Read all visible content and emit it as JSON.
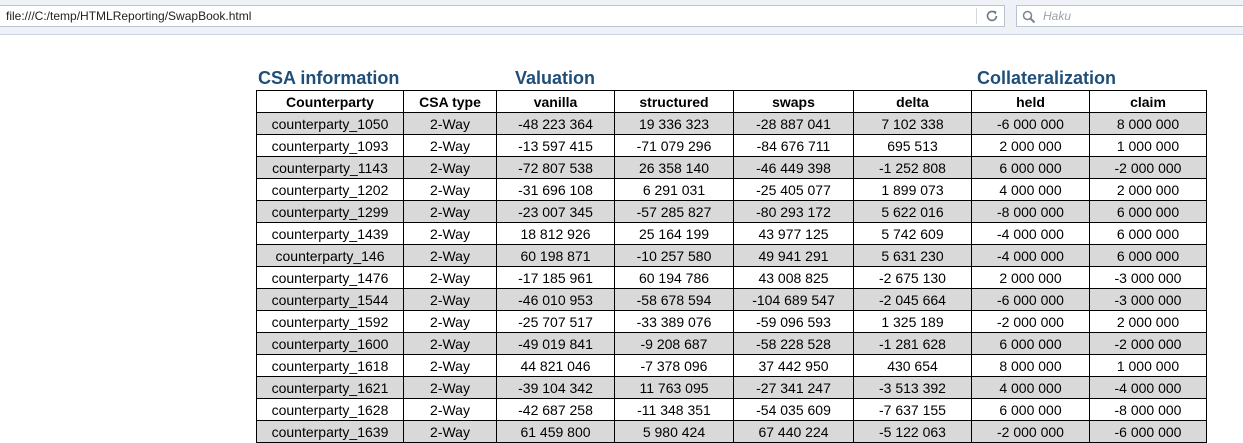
{
  "browser": {
    "url": "file:///C:/temp/HTMLReporting/SwapBook.html",
    "reload_icon": "reload-icon",
    "search_placeholder": "Haku"
  },
  "sections": {
    "csa": "CSA information",
    "valuation": "Valuation",
    "collateralization": "Collateralization"
  },
  "table": {
    "columns": [
      "Counterparty",
      "CSA type",
      "vanilla",
      "structured",
      "swaps",
      "delta",
      "held",
      "claim"
    ],
    "rows": [
      [
        "counterparty_1050",
        "2-Way",
        "-48 223 364",
        "19 336 323",
        "-28 887 041",
        "7 102 338",
        "-6 000 000",
        "8 000 000"
      ],
      [
        "counterparty_1093",
        "2-Way",
        "-13 597 415",
        "-71 079 296",
        "-84 676 711",
        "695 513",
        "2 000 000",
        "1 000 000"
      ],
      [
        "counterparty_1143",
        "2-Way",
        "-72 807 538",
        "26 358 140",
        "-46 449 398",
        "-1 252 808",
        "6 000 000",
        "-2 000 000"
      ],
      [
        "counterparty_1202",
        "2-Way",
        "-31 696 108",
        "6 291 031",
        "-25 405 077",
        "1 899 073",
        "4 000 000",
        "2 000 000"
      ],
      [
        "counterparty_1299",
        "2-Way",
        "-23 007 345",
        "-57 285 827",
        "-80 293 172",
        "5 622 016",
        "-8 000 000",
        "6 000 000"
      ],
      [
        "counterparty_1439",
        "2-Way",
        "18 812 926",
        "25 164 199",
        "43 977 125",
        "5 742 609",
        "-4 000 000",
        "6 000 000"
      ],
      [
        "counterparty_146",
        "2-Way",
        "60 198 871",
        "-10 257 580",
        "49 941 291",
        "5 631 230",
        "-4 000 000",
        "6 000 000"
      ],
      [
        "counterparty_1476",
        "2-Way",
        "-17 185 961",
        "60 194 786",
        "43 008 825",
        "-2 675 130",
        "2 000 000",
        "-3 000 000"
      ],
      [
        "counterparty_1544",
        "2-Way",
        "-46 010 953",
        "-58 678 594",
        "-104 689 547",
        "-2 045 664",
        "-6 000 000",
        "-3 000 000"
      ],
      [
        "counterparty_1592",
        "2-Way",
        "-25 707 517",
        "-33 389 076",
        "-59 096 593",
        "1 325 189",
        "-2 000 000",
        "2 000 000"
      ],
      [
        "counterparty_1600",
        "2-Way",
        "-49 019 841",
        "-9 208 687",
        "-58 228 528",
        "-1 281 628",
        "6 000 000",
        "-2 000 000"
      ],
      [
        "counterparty_1618",
        "2-Way",
        "44 821 046",
        "-7 378 096",
        "37 442 950",
        "430 654",
        "8 000 000",
        "1 000 000"
      ],
      [
        "counterparty_1621",
        "2-Way",
        "-39 104 342",
        "11 763 095",
        "-27 341 247",
        "-3 513 392",
        "4 000 000",
        "-4 000 000"
      ],
      [
        "counterparty_1628",
        "2-Way",
        "-42 687 258",
        "-11 348 351",
        "-54 035 609",
        "-7 637 155",
        "6 000 000",
        "-8 000 000"
      ],
      [
        "counterparty_1639",
        "2-Way",
        "61 459 800",
        "5 980 424",
        "67 440 224",
        "-5 122 063",
        "-2 000 000",
        "-6 000 000"
      ]
    ]
  }
}
